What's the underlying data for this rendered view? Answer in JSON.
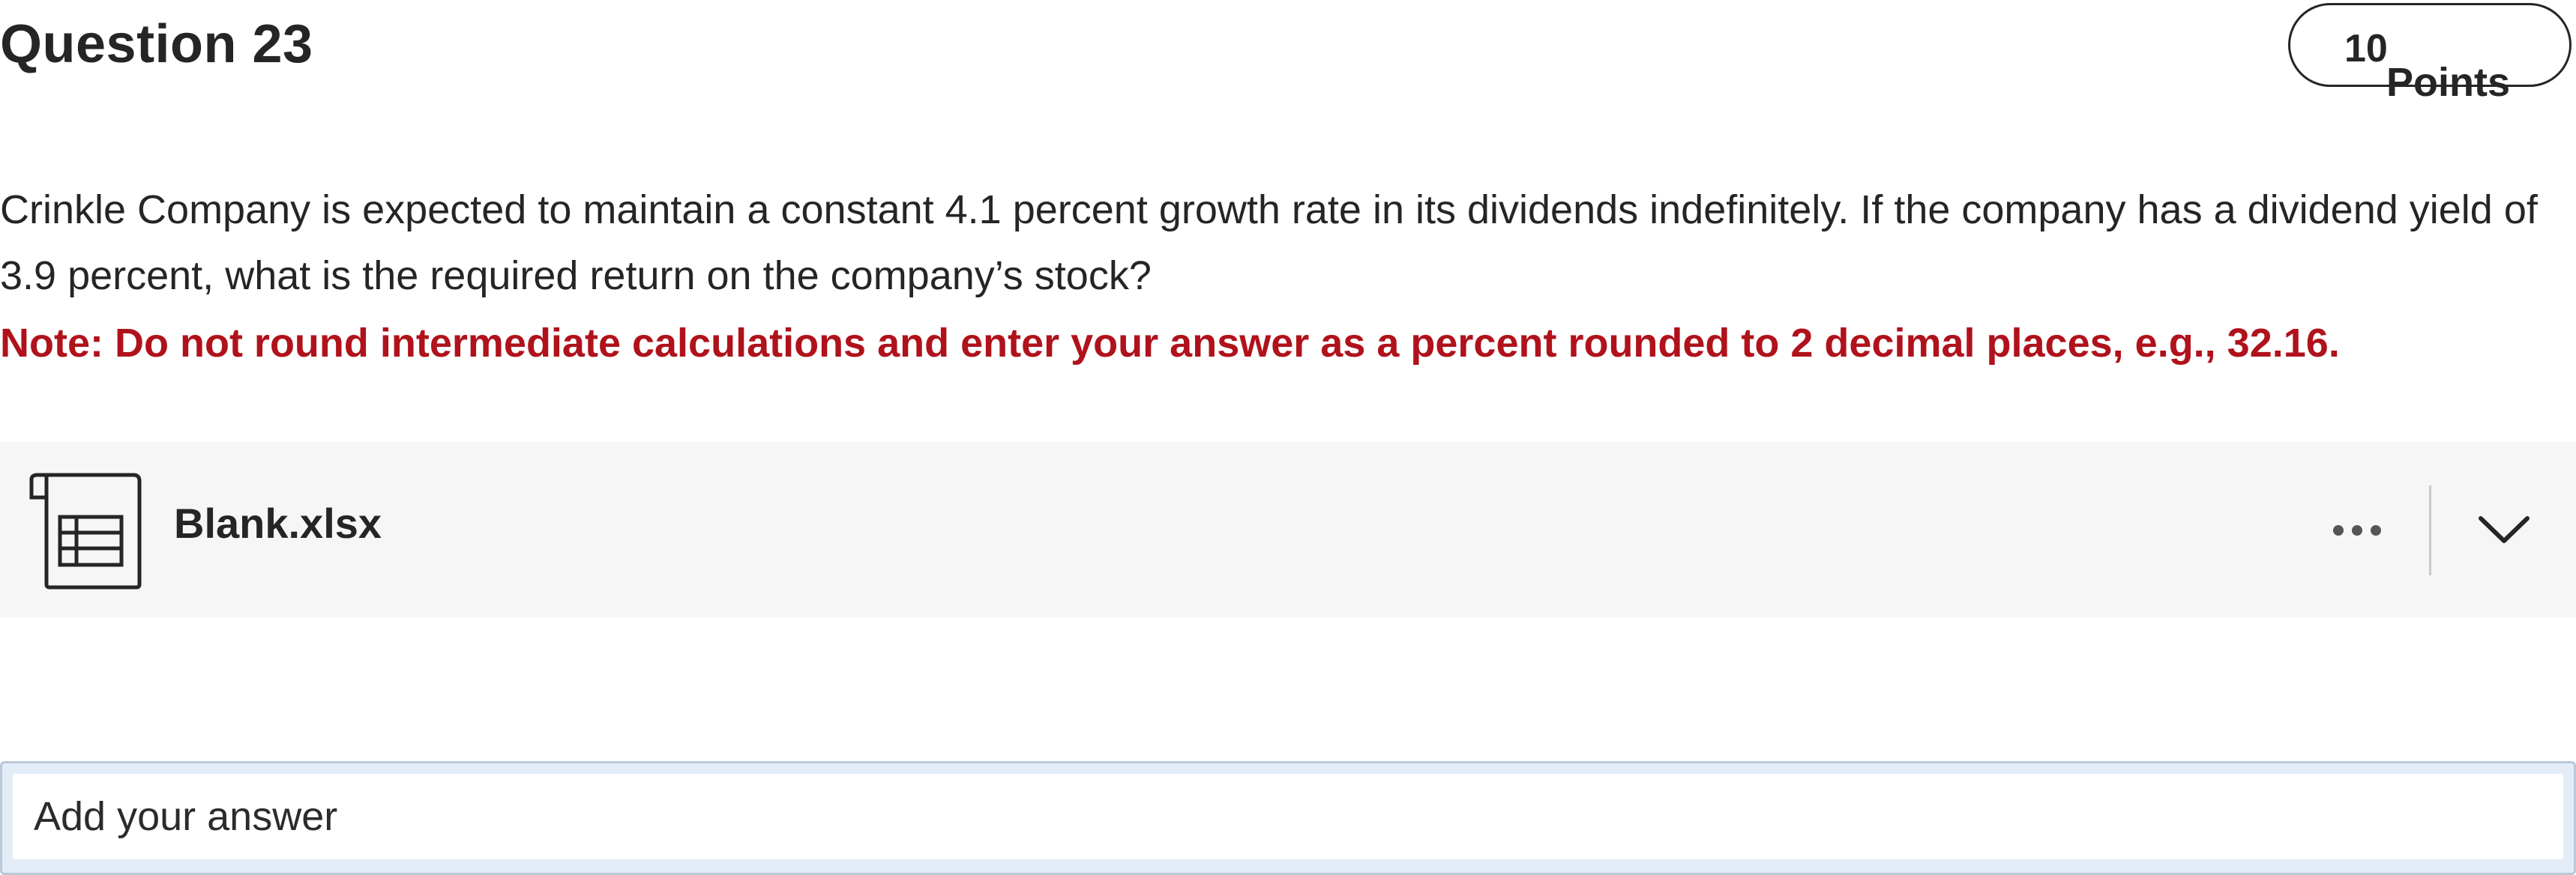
{
  "question": {
    "title": "Question 23",
    "points_value": "10",
    "points_label": "Points",
    "prompt": "Crinkle Company is expected to maintain a constant 4.1 percent growth rate in its dividends indefinitely. If the company has a dividend yield of 3.9 percent, what is the required return on the company’s stock?",
    "note": "Note: Do not round intermediate calculations and enter your answer as a percent rounded to 2 decimal places, e.g., 32.16."
  },
  "attachment": {
    "file_name": "Blank.xlsx",
    "icon": "spreadsheet-file-icon",
    "more_icon": "more-horizontal-icon",
    "expand_icon": "chevron-down-icon"
  },
  "answer": {
    "placeholder": "Add your answer",
    "value": ""
  },
  "colors": {
    "text": "#252525",
    "note": "#b0121b",
    "attachment_bg": "#f6f6f6",
    "input_focus_bg": "#e3edf7"
  }
}
